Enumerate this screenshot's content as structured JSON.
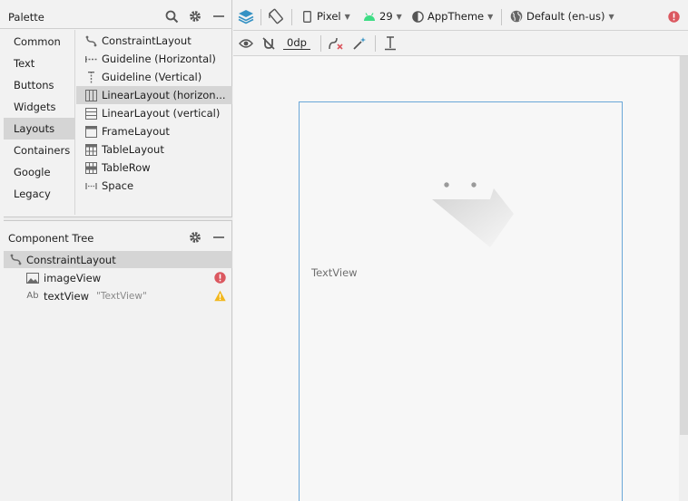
{
  "palette": {
    "title": "Palette",
    "categories": [
      "Common",
      "Text",
      "Buttons",
      "Widgets",
      "Layouts",
      "Containers",
      "Google",
      "Legacy"
    ],
    "selected_category": "Layouts",
    "items": [
      {
        "label": "ConstraintLayout",
        "icon": "constraint-layout-icon"
      },
      {
        "label": "Guideline (Horizontal)",
        "icon": "guideline-horizontal-icon"
      },
      {
        "label": "Guideline (Vertical)",
        "icon": "guideline-vertical-icon"
      },
      {
        "label": "LinearLayout (horizon...",
        "icon": "linear-layout-horizontal-icon"
      },
      {
        "label": "LinearLayout (vertical)",
        "icon": "linear-layout-vertical-icon"
      },
      {
        "label": "FrameLayout",
        "icon": "frame-layout-icon"
      },
      {
        "label": "TableLayout",
        "icon": "table-layout-icon"
      },
      {
        "label": "TableRow",
        "icon": "table-row-icon"
      },
      {
        "label": "Space",
        "icon": "space-icon"
      }
    ],
    "selected_item": "LinearLayout (horizon..."
  },
  "component_tree": {
    "title": "Component Tree",
    "root": "ConstraintLayout",
    "children": [
      {
        "label": "imageView",
        "sub": "",
        "icon": "image-icon",
        "status": "error"
      },
      {
        "label": "textView",
        "sub": "\"TextView\"",
        "icon": "text-icon",
        "status": "warning"
      }
    ]
  },
  "toolbar": {
    "device": "Pixel",
    "api": "29",
    "theme": "AppTheme",
    "locale": "Default (en-us)",
    "margin": "0dp"
  },
  "canvas": {
    "text_view": "TextView"
  },
  "colors": {
    "accent": "#3592c4",
    "error": "#db5860",
    "warning": "#f2b71c",
    "android_green": "#3ddc84",
    "selection": "#d5d5d5"
  }
}
